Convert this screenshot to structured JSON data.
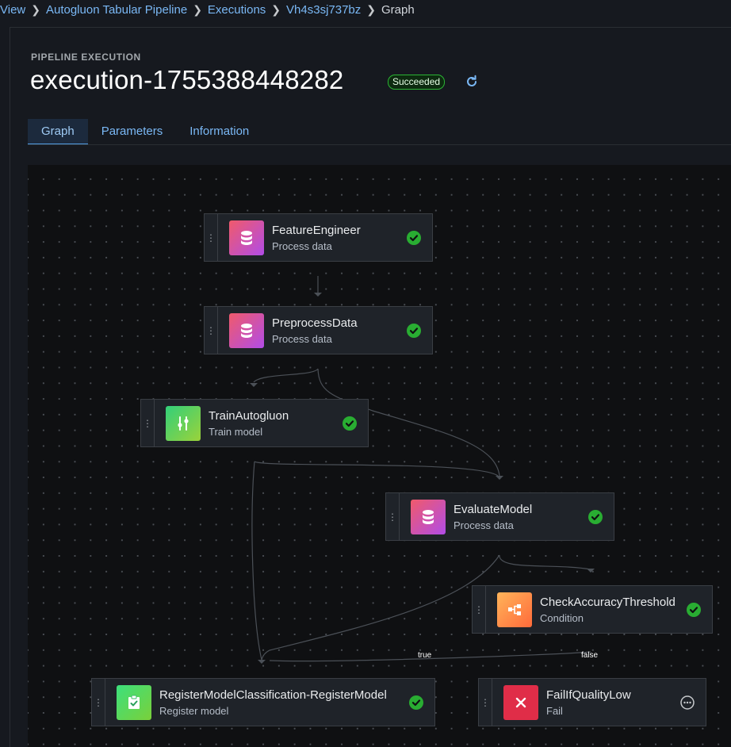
{
  "breadcrumb": {
    "items": [
      "View",
      "Autogluon Tabular Pipeline",
      "Executions",
      "Vh4s3sj737bz"
    ],
    "current": "Graph"
  },
  "header": {
    "eyebrow": "PIPELINE EXECUTION",
    "title": "execution-1755388448282",
    "status": "Succeeded",
    "refresh_icon": "refresh-icon"
  },
  "tabs": [
    {
      "label": "Graph",
      "active": true
    },
    {
      "label": "Parameters",
      "active": false
    },
    {
      "label": "Information",
      "active": false
    }
  ],
  "graph": {
    "nodes": [
      {
        "name": "FeatureEngineer",
        "type": "Process data",
        "icon": "database-icon",
        "status": "succeeded"
      },
      {
        "name": "PreprocessData",
        "type": "Process data",
        "icon": "database-icon",
        "status": "succeeded"
      },
      {
        "name": "TrainAutogluon",
        "type": "Train model",
        "icon": "sliders-icon",
        "status": "succeeded"
      },
      {
        "name": "EvaluateModel",
        "type": "Process data",
        "icon": "database-icon",
        "status": "succeeded"
      },
      {
        "name": "CheckAccuracyThreshold",
        "type": "Condition",
        "icon": "branch-icon",
        "status": "succeeded"
      },
      {
        "name": "RegisterModelClassification-RegisterModel",
        "type": "Register model",
        "icon": "clipboard-check-icon",
        "status": "succeeded"
      },
      {
        "name": "FailIfQualityLow",
        "type": "Fail",
        "icon": "close-icon",
        "status": "not-executed"
      }
    ],
    "edge_labels": {
      "true": "true",
      "false": "false"
    }
  },
  "colors": {
    "link": "#7ab8f5",
    "success": "#29ad32",
    "background": "#16191f",
    "canvas": "#0f1012"
  }
}
